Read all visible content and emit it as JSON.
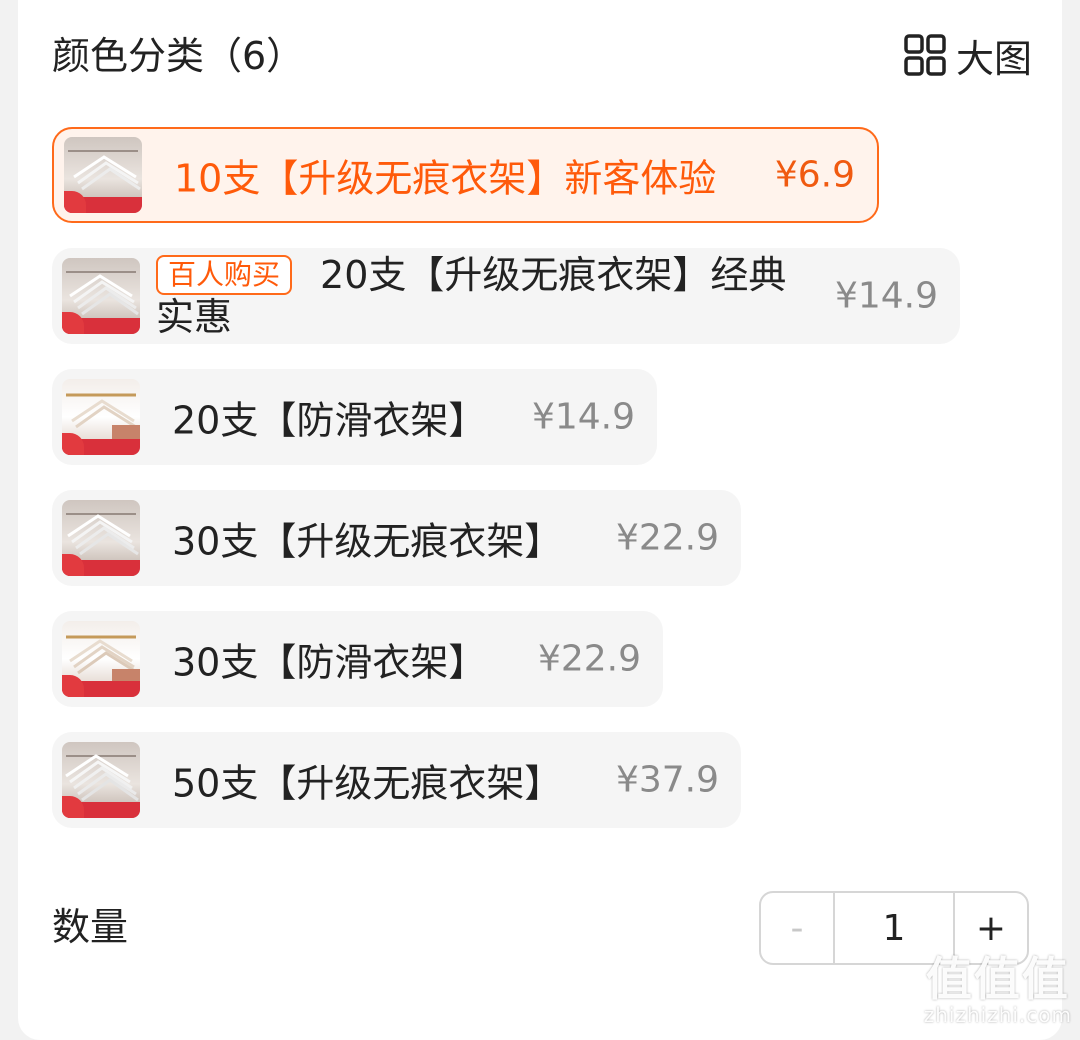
{
  "header": {
    "title": "颜色分类（6）",
    "big_image_label": "大图"
  },
  "options": [
    {
      "label": "10支【升级无痕衣架】新客体验",
      "price": "¥6.9",
      "selected": true,
      "thumb_icon": "hanger-thumbnail"
    },
    {
      "tag": "百人购买",
      "label": "20支【升级无痕衣架】经典实惠",
      "price": "¥14.9",
      "selected": false,
      "thumb_icon": "hanger-thumbnail"
    },
    {
      "label": "20支【防滑衣架】",
      "price": "¥14.9",
      "selected": false,
      "thumb_icon": "hanger-thumbnail"
    },
    {
      "label": "30支【升级无痕衣架】",
      "price": "¥22.9",
      "selected": false,
      "thumb_icon": "hanger-thumbnail"
    },
    {
      "label": "30支【防滑衣架】",
      "price": "¥22.9",
      "selected": false,
      "thumb_icon": "hanger-thumbnail"
    },
    {
      "label": "50支【升级无痕衣架】",
      "price": "¥37.9",
      "selected": false,
      "thumb_icon": "hanger-thumbnail"
    }
  ],
  "quantity": {
    "label": "数量",
    "minus": "-",
    "value": "1",
    "plus": "+"
  },
  "watermark": {
    "main": "值值值",
    "url": "zhizhizhi.com"
  },
  "colors": {
    "accent": "#ff5a0a",
    "selected_bg": "#fff3ec",
    "chip_bg": "#f5f5f5",
    "price_gray": "#8a8a8a"
  }
}
